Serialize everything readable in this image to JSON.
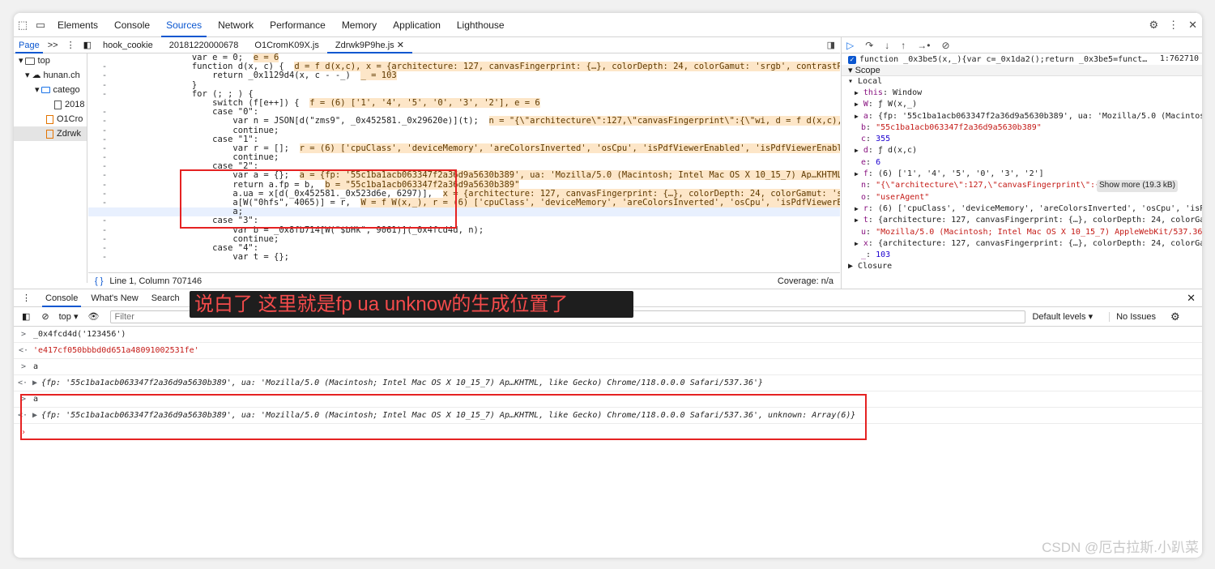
{
  "devtools": {
    "tabs": [
      "Elements",
      "Console",
      "Sources",
      "Network",
      "Performance",
      "Memory",
      "Application",
      "Lighthouse"
    ],
    "active_tab": "Sources"
  },
  "sources": {
    "navigator_label": "Page",
    "navigator_more": ">>",
    "file_tabs": [
      "hook_cookie",
      "20181220000678",
      "O1CromK09X.js",
      "Zdrwk9P9he.js"
    ],
    "active_file": "Zdrwk9P9he.js",
    "tree": [
      "top",
      "hunan.ch",
      "catego",
      "2018",
      "O1Cro",
      "Zdrwk"
    ],
    "status_position": "Line 1, Column 707146",
    "status_coverage": "Coverage: n/a",
    "code_lines": [
      {
        "gutter": "",
        "text": "var e = 0;",
        "inline": "e = 6"
      },
      {
        "gutter": "-",
        "text": "function d(x, c) {",
        "inline": "d = f d(x,c), x = {architecture: 127, canvasFingerprint: {…}, colorDepth: 24, colorGamut: 'srgb', contrastPreference: 0,"
      },
      {
        "gutter": "-",
        "text": "    return _0x1129d4(x, c - -_)",
        "inline": "_ = 103"
      },
      {
        "gutter": "-",
        "text": "}",
        "inline": ""
      },
      {
        "gutter": "-",
        "text": "for (; ; ) {",
        "inline": ""
      },
      {
        "gutter": "",
        "text": "    switch (f[e++]) {",
        "inline": "f = (6) ['1', '4', '5', '0', '3', '2'], e = 6"
      },
      {
        "gutter": "-",
        "text": "    case \"0\":",
        "inline": ""
      },
      {
        "gutter": "-",
        "text": "        var n = JSON[d(\"zms9\", _0x452581._0x29620e)](t);",
        "inline": "n = \"{\\\"architecture\\\":127,\\\"canvasFingerprint\\\":{\\\"wi, d = f d(x,c), t = {archite"
      },
      {
        "gutter": "-",
        "text": "        continue;",
        "inline": ""
      },
      {
        "gutter": "-",
        "text": "    case \"1\":",
        "inline": ""
      },
      {
        "gutter": "-",
        "text": "        var r = [];",
        "inline": "r = (6) ['cpuClass', 'deviceMemory', 'areColorsInverted', 'osCpu', 'isPdfViewerEnabled', 'isPdfViewerEnabled']"
      },
      {
        "gutter": "-",
        "text": "        continue;",
        "inline": ""
      },
      {
        "gutter": "-",
        "text": "    case \"2\":",
        "inline": ""
      },
      {
        "gutter": "-",
        "text": "        var a = {};",
        "inline": "a = {fp: '55c1ba1acb063347f2a36d9a5630b389', ua: 'Mozilla/5.0 (Macintosh; Intel Mac OS X 10_15_7) Ap…KHTML, like Gecko)"
      },
      {
        "gutter": "-",
        "text": "        return a.fp = b,",
        "inline": "b = \"55c1ba1acb063347f2a36d9a5630b389\""
      },
      {
        "gutter": "-",
        "text": "        a.ua = x[d(_0x452581._0x523d6e, 6297)],",
        "inline": "x = {architecture: 127, canvasFingerprint: {…}, colorDepth: 24, colorGamut: 'srgb', contras"
      },
      {
        "gutter": "-",
        "text": "        a[W(\"0hfs\", 4065)] = r,",
        "inline": "W = f W(x,_), r = (6) ['cpuClass', 'deviceMemory', 'areColorsInverted', 'osCpu', 'isPdfViewerEnabled', 'isP"
      },
      {
        "gutter": "",
        "text": "        a;",
        "inline": ""
      },
      {
        "gutter": "-",
        "text": "    case \"3\":",
        "inline": ""
      },
      {
        "gutter": "-",
        "text": "        var b = _0x8fb714[W(\"$bHk\", 9061)](_0x4fcd4d, n);",
        "inline": ""
      },
      {
        "gutter": "-",
        "text": "        continue;",
        "inline": ""
      },
      {
        "gutter": "-",
        "text": "    case \"4\":",
        "inline": ""
      },
      {
        "gutter": "-",
        "text": "        var t = {};",
        "inline": ""
      }
    ]
  },
  "debugger": {
    "callstack_line": "function _0x3be5(x,_){var c=_0x1da2();return _0x3be5=funct…",
    "callstack_loc": "1:762710",
    "scope_label": "Scope",
    "local_label": "Local",
    "closure_label": "Closure",
    "show_more": "Show more (19.3 kB)",
    "scope_vars": [
      {
        "key": "this",
        "value": "Window",
        "arrow": "▶"
      },
      {
        "key": "W",
        "value": "ƒ W(x,_)",
        "arrow": "▶"
      },
      {
        "key": "a",
        "value": "{fp: '55c1ba1acb063347f2a36d9a5630b389', ua: 'Mozilla/5.0 (Macintosh",
        "arrow": "▶"
      },
      {
        "key": "b",
        "value": "\"55c1ba1acb063347f2a36d9a5630b389\"",
        "arrow": ""
      },
      {
        "key": "c",
        "value": "355",
        "arrow": ""
      },
      {
        "key": "d",
        "value": "ƒ d(x,c)",
        "arrow": "▶"
      },
      {
        "key": "e",
        "value": "6",
        "arrow": ""
      },
      {
        "key": "f",
        "value": "(6) ['1', '4', '5', '0', '3', '2']",
        "arrow": "▶"
      },
      {
        "key": "n",
        "value": "\"{\\\"architecture\\\":127,\\\"canvasFingerprint\\\":{\\\"wi",
        "arrow": ""
      },
      {
        "key": "o",
        "value": "\"userAgent\"",
        "arrow": ""
      },
      {
        "key": "r",
        "value": "(6) ['cpuClass', 'deviceMemory', 'areColorsInverted', 'osCpu', 'isPd",
        "arrow": "▶"
      },
      {
        "key": "t",
        "value": "{architecture: 127, canvasFingerprint: {…}, colorDepth: 24, colorGam",
        "arrow": "▶"
      },
      {
        "key": "u",
        "value": "\"Mozilla/5.0 (Macintosh; Intel Mac OS X 10_15_7) AppleWebKit/537.36",
        "arrow": ""
      },
      {
        "key": "x",
        "value": "{architecture: 127, canvasFingerprint: {…}, colorDepth: 24, colorGam",
        "arrow": "▶"
      },
      {
        "key": "_",
        "value": "103",
        "arrow": ""
      }
    ]
  },
  "drawer": {
    "tabs": [
      "Console",
      "What's New",
      "Search"
    ],
    "context": "top",
    "filter_placeholder": "Filter",
    "levels": "Default levels",
    "issues": "No Issues",
    "lines": [
      {
        "prefix": ">",
        "text": "_0x4fcd4d('123456')",
        "kind": "input"
      },
      {
        "prefix": "<·",
        "text": "'e417cf050bbbd0d651a48091002531fe'",
        "kind": "string"
      },
      {
        "prefix": ">",
        "text": "a",
        "kind": "input"
      },
      {
        "prefix": "<· ▶",
        "text": "{fp: '55c1ba1acb063347f2a36d9a5630b389', ua: 'Mozilla/5.0 (Macintosh; Intel Mac OS X 10_15_7) Ap…KHTML, like Gecko) Chrome/118.0.0.0 Safari/537.36'}",
        "kind": "object"
      },
      {
        "prefix": ">",
        "text": "a",
        "kind": "input"
      },
      {
        "prefix": "<· ▶",
        "text": "{fp: '55c1ba1acb063347f2a36d9a5630b389', ua: 'Mozilla/5.0 (Macintosh; Intel Mac OS X 10_15_7) Ap…KHTML, like Gecko) Chrome/118.0.0.0 Safari/537.36', unknown: Array(6)}",
        "kind": "object"
      }
    ]
  },
  "annotation": "说白了 这里就是fp ua unknow的生成位置了",
  "watermark": "CSDN @厄古拉斯.小趴菜",
  "colors": {
    "accent": "#0b57d0",
    "annotation_red": "#e52222",
    "inline_value_bg": "#fde6c8"
  }
}
